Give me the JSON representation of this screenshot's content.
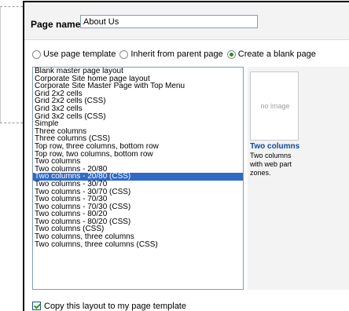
{
  "page_name": {
    "label": "Page name:",
    "value": "About Us"
  },
  "template_options": [
    {
      "label": "Use page template",
      "checked": false
    },
    {
      "label": "Inherit from parent page",
      "checked": false
    },
    {
      "label": "Create a blank page",
      "checked": true
    }
  ],
  "layouts": {
    "selected_index": 14,
    "items": [
      "Blank master page layout",
      "Corporate Site home page layout",
      "Corporate Site Master Page with Top Menu",
      "Grid 2x2 cells",
      "Grid 2x2 cells (CSS)",
      "Grid 3x2 cells",
      "Grid 3x2 cells (CSS)",
      "Simple",
      "Three columns",
      "Three columns (CSS)",
      "Top row, three columns, bottom row",
      "Top row, two columns, bottom row",
      "Two columns",
      "Two columns - 20/80",
      "Two columns - 20/80 (CSS)",
      "Two columns - 30/70",
      "Two columns - 30/70 (CSS)",
      "Two columns - 70/30",
      "Two columns - 70/30 (CSS)",
      "Two columns - 80/20",
      "Two columns - 80/20 (CSS)",
      "Two columns (CSS)",
      "Two columns, three columns",
      "Two columns, three columns (CSS)"
    ]
  },
  "preview": {
    "no_image_text": "no image",
    "title": "Two columns",
    "description": "Two columns with web part zones."
  },
  "copy_layout": {
    "label": "Copy this layout to my page template",
    "checked": true
  },
  "colors": {
    "selection": "#316ac5",
    "preview_title": "#0b4a9c",
    "header_bg": "#f3f3f3"
  }
}
